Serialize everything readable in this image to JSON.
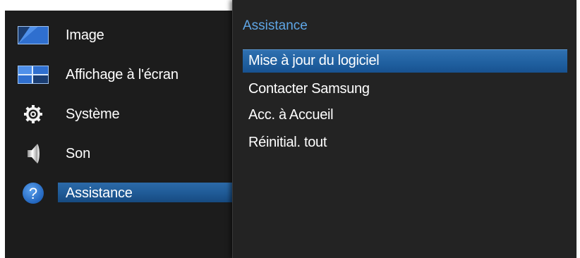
{
  "main_menu": {
    "items": [
      {
        "label": "Image",
        "icon": "picture-icon"
      },
      {
        "label": "Affichage à l'écran",
        "icon": "onscreen-display-icon"
      },
      {
        "label": "Système",
        "icon": "gear-icon"
      },
      {
        "label": "Son",
        "icon": "speaker-icon"
      },
      {
        "label": "Assistance",
        "icon": "help-icon",
        "selected": true
      }
    ]
  },
  "submenu": {
    "title": "Assistance",
    "items": [
      {
        "label": "Mise à jour du logiciel",
        "selected": true
      },
      {
        "label": "Contacter Samsung"
      },
      {
        "label": "Acc. à Accueil"
      },
      {
        "label": "Réinitial. tout"
      }
    ]
  },
  "colors": {
    "panel_bg": "#1c1c1c",
    "submenu_bg": "#232323",
    "highlight": "#1f5f9f",
    "title_accent": "#5fa6e6"
  }
}
